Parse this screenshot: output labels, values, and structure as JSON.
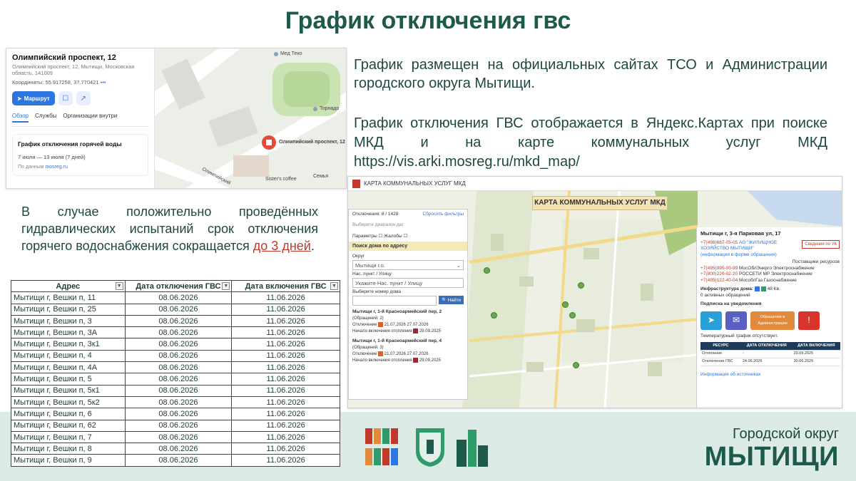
{
  "page": {
    "title": "График отключения гвс"
  },
  "yandex_card": {
    "address_title": "Олимпийский проспект, 12",
    "address_sub": "Олимпийский проспект, 12, Мытищи, Московская область, 141009",
    "coords_label": "Координаты:",
    "coords_value": "55.917258, 37.770421",
    "route_button": "Маршрут",
    "tabs": [
      "Обзор",
      "Службы",
      "Организации внутри"
    ],
    "schedule_heading": "График отключения горячей воды",
    "schedule_dates": "7 июля — 13 июля (7 дней)",
    "schedule_source_prefix": "По данным",
    "schedule_source_link": "mosreg.ru",
    "map_labels": {
      "pin": "Олимпийский проспект, 12",
      "medteko": "Мед Теко",
      "tornado": "Торнадо",
      "street": "Олимпийский",
      "sisters": "Sister's coffee",
      "semya": "Семья"
    }
  },
  "text": {
    "para1": "График размещен на официальных сайтах ТСО и Администрации городского округа Мытищи.",
    "para2": "График отключения ГВС отображается в Яндекс.Картах при поиске МКД и на карте коммунальных услуг МКД https://vis.arki.mosreg.ru/mkd_map/",
    "para3_main": "В случае положительно проведённых гидравлических испытаний срок отключения горячего водоснабжения сокращается ",
    "para3_highlight": "до 3 дней",
    "para3_end": "."
  },
  "table": {
    "headers": [
      "Адрес",
      "Дата отключения ГВС",
      "Дата включения ГВС"
    ],
    "rows": [
      [
        "Мытищи г, Вешки п, 11",
        "08.06.2026",
        "11.06.2026"
      ],
      [
        "Мытищи г, Вешки п, 25",
        "08.06.2026",
        "11.06.2026"
      ],
      [
        "Мытищи г, Вешки п, 3",
        "08.06.2026",
        "11.06.2026"
      ],
      [
        "Мытищи г, Вешки п, 3А",
        "08.06.2026",
        "11.06.2026"
      ],
      [
        "Мытищи г, Вешки п, 3к1",
        "08.06.2026",
        "11.06.2026"
      ],
      [
        "Мытищи г, Вешки п, 4",
        "08.06.2026",
        "11.06.2026"
      ],
      [
        "Мытищи г, Вешки п, 4А",
        "08.06.2026",
        "11.06.2026"
      ],
      [
        "Мытищи г, Вешки п, 5",
        "08.06.2026",
        "11.06.2026"
      ],
      [
        "Мытищи г, Вешки п, 5к1",
        "08.06.2026",
        "11.06.2026"
      ],
      [
        "Мытищи г, Вешки п, 5к2",
        "08.06.2026",
        "11.06.2026"
      ],
      [
        "Мытищи г, Вешки п, 6",
        "08.06.2026",
        "11.06.2026"
      ],
      [
        "Мытищи г, Вешки п, 62",
        "08.06.2026",
        "11.06.2026"
      ],
      [
        "Мытищи г, Вешки п, 7",
        "08.06.2026",
        "11.06.2026"
      ],
      [
        "Мытищи г, Вешки п, 8",
        "08.06.2026",
        "11.06.2026"
      ],
      [
        "Мытищи г, Вешки п, 9",
        "08.06.2026",
        "11.06.2026"
      ]
    ]
  },
  "mkd_map": {
    "top_title": "КАРТА КОММУНАЛЬНЫХ УСЛУГ МКД",
    "banner": "КАРТА КОММУНАЛЬНЫХ УСЛУГ МКД",
    "filter": {
      "count": "Отключения: 8 / 1428",
      "reset": "Сбросить фильтры",
      "choose_date": "Выберите диапазон дат",
      "params": "Параметры",
      "complaints": "Жалобы",
      "search_heading": "Поиск дома по адресу",
      "district_label": "Округ",
      "district_value": "Мытищи г.о.",
      "locality_label": "Нас. пункт / Улицу",
      "locality_placeholder": "Укажите Нас. пункт / Улицу",
      "house_label": "Выберите номер дома",
      "find_button": "Найти",
      "result1_title": "Мытищи г, 1-й Красноармейский пер, 2",
      "result1_count": "(Обращений: 2)",
      "result2_title": "Мытищи г, 1-й Красноармейский пер, 4",
      "result2_count": "(Обращений: 3)",
      "outage_label": "Отключение",
      "outage_from": "21.07.2026",
      "outage_to": "27.07.2026",
      "heating_label": "Начало включения отопления",
      "heating_date": "29.09.2025"
    },
    "info": {
      "address": "Мытищи г, 3-я Парковая ул, 17",
      "badge": "Сведения по УК",
      "phone1": "+7(498)687-05-05",
      "uk_name": "АО \"ЖИЛИЩНОЕ ХОЗЯЙСТВО МЫТИЩИ\"",
      "uk_link": "(информация в форме обращения)",
      "suppliers_label": "Поставщики ресурсов",
      "phones": [
        [
          "+7(495)995-00-99",
          "МосОблЭнерго Электроснабжение"
        ],
        [
          "+7(800)220-02-20",
          "РОССЕТИ МР Электроснабжение"
        ],
        [
          "+7(495)122-40-04",
          "МособлГаз Газоснабжение"
        ]
      ],
      "infra_label": "Инфраструктура дома:",
      "infra_kv": "48 Кв.",
      "active_requests": "0 активных обращений",
      "subscribe": "Подписка на уведомления",
      "admin_button": "Обращение в Администрацию",
      "temp_note": "Температурный график отсутствует.",
      "tbl_headers": [
        "РЕСУРС",
        "ДАТА ОТКЛЮЧЕНИЯ",
        "ДАТА ВКЛЮЧЕНИЯ"
      ],
      "tbl_rows": [
        [
          "Отопление",
          "-",
          "29.09.2025"
        ],
        [
          "Отключение ГВС",
          "24.06.2026",
          "30.06.2026"
        ]
      ],
      "source_link": "Информация об источниках"
    }
  },
  "branding": {
    "sub": "Городской округ",
    "main": "МЫТИЩИ"
  },
  "colors": {
    "title_green": "#1e5a4c",
    "band": "#dcebe6",
    "highlight_red": "#c0392b"
  }
}
